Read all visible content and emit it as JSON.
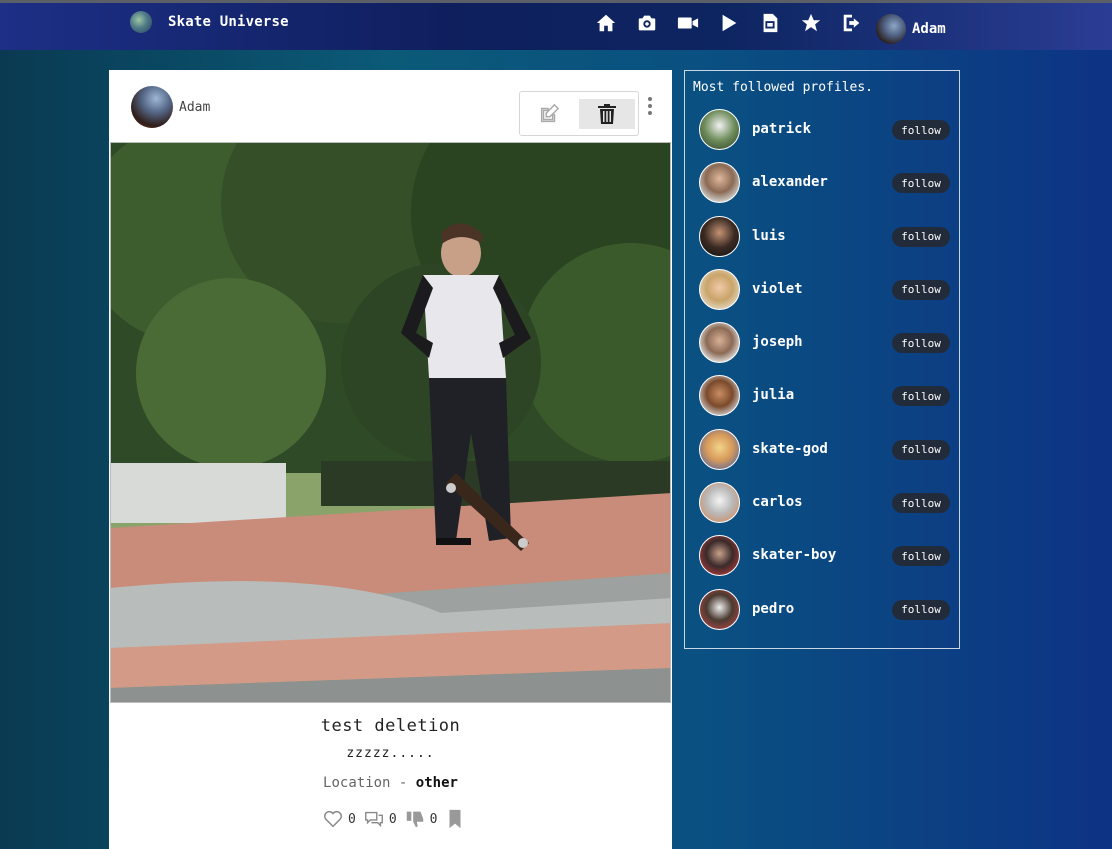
{
  "app": {
    "title": "Skate Universe"
  },
  "nav": {
    "icons": [
      "home-icon",
      "camera-icon",
      "video-icon",
      "play-icon",
      "document-icon",
      "star-icon",
      "logout-icon"
    ],
    "user_name": "Adam"
  },
  "post": {
    "user_name": "Adam",
    "number": "2",
    "title": "test deletion",
    "description": "zzzzz.....",
    "location_label": "Location",
    "location_sep": "-",
    "location_value": "other",
    "likes": "0",
    "comments": "0",
    "dislikes": "0"
  },
  "sidebar": {
    "title": "Most followed profiles.",
    "follow_label": "follow",
    "profiles": [
      {
        "name": "patrick"
      },
      {
        "name": "alexander"
      },
      {
        "name": "luis"
      },
      {
        "name": "violet"
      },
      {
        "name": "joseph"
      },
      {
        "name": "julia"
      },
      {
        "name": "skate-god"
      },
      {
        "name": "carlos"
      },
      {
        "name": "skater-boy"
      },
      {
        "name": "pedro"
      }
    ]
  }
}
